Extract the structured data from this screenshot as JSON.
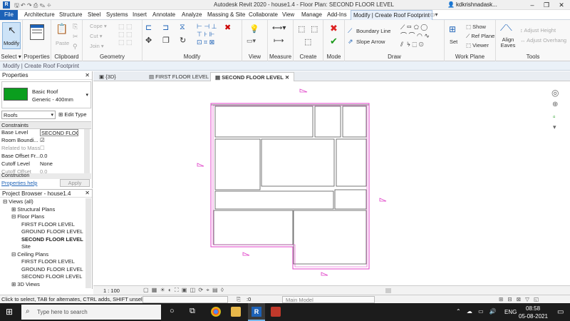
{
  "titlebar": {
    "title": "Autodesk Revit 2020 - house1.4 - Floor Plan: SECOND FLOOR LEVEL",
    "user": "kdkrishnadask...",
    "minimize": "–",
    "restore": "❐",
    "close": "✕"
  },
  "menu": [
    "File",
    "Architecture",
    "Structure",
    "Steel",
    "Systems",
    "Insert",
    "Annotate",
    "Analyze",
    "Massing & Site",
    "Collaborate",
    "View",
    "Manage",
    "Add-Ins",
    "Modify | Create Roof Footprint"
  ],
  "ribbon": {
    "select": {
      "modify": "Modify",
      "label": "Select ▾"
    },
    "properties": {
      "label": "Properties"
    },
    "clipboard": {
      "paste": "Paste",
      "label": "Clipboard"
    },
    "geometry": {
      "cope": "Cope ▾",
      "cut": "Cut ▾",
      "join": "Join ▾",
      "label": "Geometry"
    },
    "modify": {
      "label": "Modify"
    },
    "view": {
      "label": "View"
    },
    "measure": {
      "label": "Measure"
    },
    "create": {
      "label": "Create"
    },
    "mode": {
      "label": "Mode"
    },
    "draw": {
      "boundary_line": "Boundary Line",
      "slope_arrow": "Slope Arrow",
      "label": "Draw"
    },
    "workplane": {
      "set": "Set",
      "show": "Show",
      "ref_plane": "Ref Plane",
      "viewer": "Viewer",
      "label": "Work Plane"
    },
    "tools": {
      "align_eaves": "Align Eaves",
      "adjust_height": "Adjust Height",
      "adjust_overhang": "Adjust Overhang",
      "label": "Tools"
    }
  },
  "context_bar": "Modify | Create Roof Footprint",
  "properties": {
    "title": "Properties",
    "type_name": "Basic Roof",
    "type_sub": "Generic - 400mm",
    "category": "Roofs",
    "edit_type": "Edit Type",
    "section": "Constraints",
    "rows": [
      {
        "name": "Base Level",
        "value": "SECOND FLOC"
      },
      {
        "name": "Room Boundi...",
        "value": "☑"
      },
      {
        "name": "Related to Mass",
        "value": "☐"
      },
      {
        "name": "Base Offset Fr...",
        "value": "0.0"
      },
      {
        "name": "Cutoff Level",
        "value": "None"
      },
      {
        "name": "Cutoff Offset",
        "value": "0.0"
      }
    ],
    "section2": "Construction",
    "help": "Properties help",
    "apply": "Apply"
  },
  "browser": {
    "title": "Project Browser - house1.4",
    "items": [
      {
        "label": "Views (all)",
        "indent": 0,
        "exp": "⊟"
      },
      {
        "label": "Structural Plans",
        "indent": 1,
        "exp": "⊞"
      },
      {
        "label": "Floor Plans",
        "indent": 1,
        "exp": "⊟"
      },
      {
        "label": "FIRST FLOOR LEVEL",
        "indent": 2,
        "exp": ""
      },
      {
        "label": "GROUND FLOOR LEVEL",
        "indent": 2,
        "exp": ""
      },
      {
        "label": "SECOND FLOOR LEVEL",
        "indent": 2,
        "exp": "",
        "bold": true
      },
      {
        "label": "Site",
        "indent": 2,
        "exp": ""
      },
      {
        "label": "Ceiling Plans",
        "indent": 1,
        "exp": "⊟"
      },
      {
        "label": "FIRST FLOOR LEVEL",
        "indent": 2,
        "exp": ""
      },
      {
        "label": "GROUND FLOOR LEVEL",
        "indent": 2,
        "exp": ""
      },
      {
        "label": "SECOND FLOOR LEVEL",
        "indent": 2,
        "exp": ""
      },
      {
        "label": "3D Views",
        "indent": 1,
        "exp": "⊞"
      }
    ]
  },
  "tabs": [
    {
      "label": "{3D}",
      "active": false
    },
    {
      "label": "FIRST FLOOR LEVEL",
      "active": false
    },
    {
      "label": "SECOND FLOOR LEVEL",
      "active": true
    }
  ],
  "tab_close": "✕",
  "view_scale": "1 : 100",
  "status": {
    "message": "Click to select, TAB for alternates, CTRL adds, SHIFT unselects.",
    "workset_value": ":0",
    "model": "Main Model"
  },
  "taskbar": {
    "search": "Type here to search",
    "lang": "ENG",
    "time": "08:58",
    "date": "05-08-2021"
  },
  "colors": {
    "accent": "#1d62b7",
    "sketch_magenta": "#e040c8",
    "roof_green": "#0a9e1e"
  }
}
